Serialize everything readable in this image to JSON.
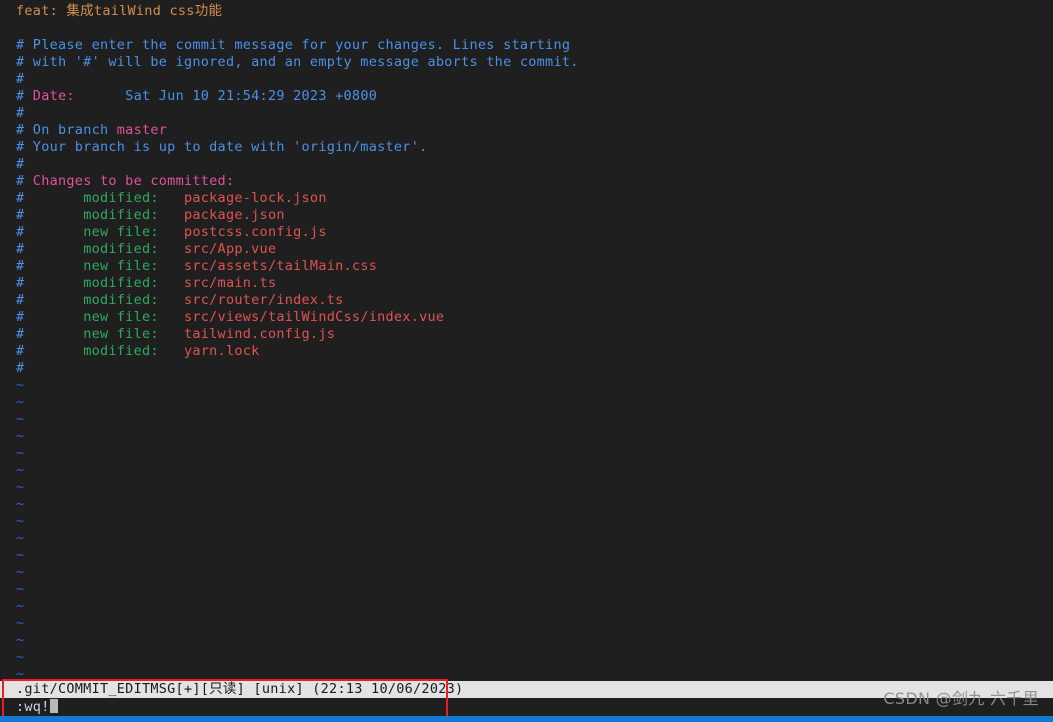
{
  "editor": {
    "app": "vim",
    "colors": {
      "background": "#1f1f1f",
      "subject": "#d08f4b",
      "comment": "#4a90e8",
      "key": "#e0529b",
      "status_added": "#2cab5e",
      "filename": "#e05252",
      "tilde": "#2a5fe8",
      "statusbar_bg": "#e3e3e3",
      "statusbar_fg": "#1a1a1a",
      "annotation_box": "#ee1c25",
      "bottom_strip": "#1479d0"
    },
    "buffer": [
      {
        "kind": "subject",
        "text": "feat: 集成tailWind css功能"
      },
      {
        "kind": "blank",
        "text": ""
      },
      {
        "kind": "comment",
        "text": "# Please enter the commit message for your changes. Lines starting"
      },
      {
        "kind": "comment",
        "text": "# with '#' will be ignored, and an empty message aborts the commit."
      },
      {
        "kind": "hash",
        "text": "#"
      },
      {
        "kind": "keyval",
        "hash": "#",
        "key": " Date:",
        "value": "      Sat Jun 10 21:54:29 2023 +0800"
      },
      {
        "kind": "hash",
        "text": "#"
      },
      {
        "kind": "branch",
        "hash": "#",
        "pre": " On branch ",
        "name": "master"
      },
      {
        "kind": "comment",
        "text": "# Your branch is up to date with 'origin/master'."
      },
      {
        "kind": "hash",
        "text": "#"
      },
      {
        "kind": "header",
        "hash": "#",
        "text": " Changes to be committed:"
      },
      {
        "kind": "file",
        "hash": "#",
        "status": "modified:",
        "name": "package-lock.json"
      },
      {
        "kind": "file",
        "hash": "#",
        "status": "modified:",
        "name": "package.json"
      },
      {
        "kind": "file",
        "hash": "#",
        "status": "new file:",
        "name": "postcss.config.js"
      },
      {
        "kind": "file",
        "hash": "#",
        "status": "modified:",
        "name": "src/App.vue"
      },
      {
        "kind": "file",
        "hash": "#",
        "status": "new file:",
        "name": "src/assets/tailMain.css"
      },
      {
        "kind": "file",
        "hash": "#",
        "status": "modified:",
        "name": "src/main.ts"
      },
      {
        "kind": "file",
        "hash": "#",
        "status": "modified:",
        "name": "src/router/index.ts"
      },
      {
        "kind": "file",
        "hash": "#",
        "status": "new file:",
        "name": "src/views/tailWindCss/index.vue"
      },
      {
        "kind": "file",
        "hash": "#",
        "status": "new file:",
        "name": "tailwind.config.js"
      },
      {
        "kind": "file",
        "hash": "#",
        "status": "modified:",
        "name": "yarn.lock"
      },
      {
        "kind": "hash",
        "text": "#"
      }
    ],
    "tilde_marker": "~",
    "tilde_count": 18
  },
  "statusbar": {
    "filename": ".git/COMMIT_EDITMSG",
    "modified_flag": "[+]",
    "readonly_flag": "[只读]",
    "fileformat": "[unix]",
    "timestamp": "(22:13 10/06/2023)",
    "full_text": ".git/COMMIT_EDITMSG[+][只读] [unix] (22:13 10/06/2023)"
  },
  "commandline": {
    "command": ":wq!",
    "cursor": "block"
  },
  "watermark": {
    "text": "CSDN @剑九 六千里"
  }
}
